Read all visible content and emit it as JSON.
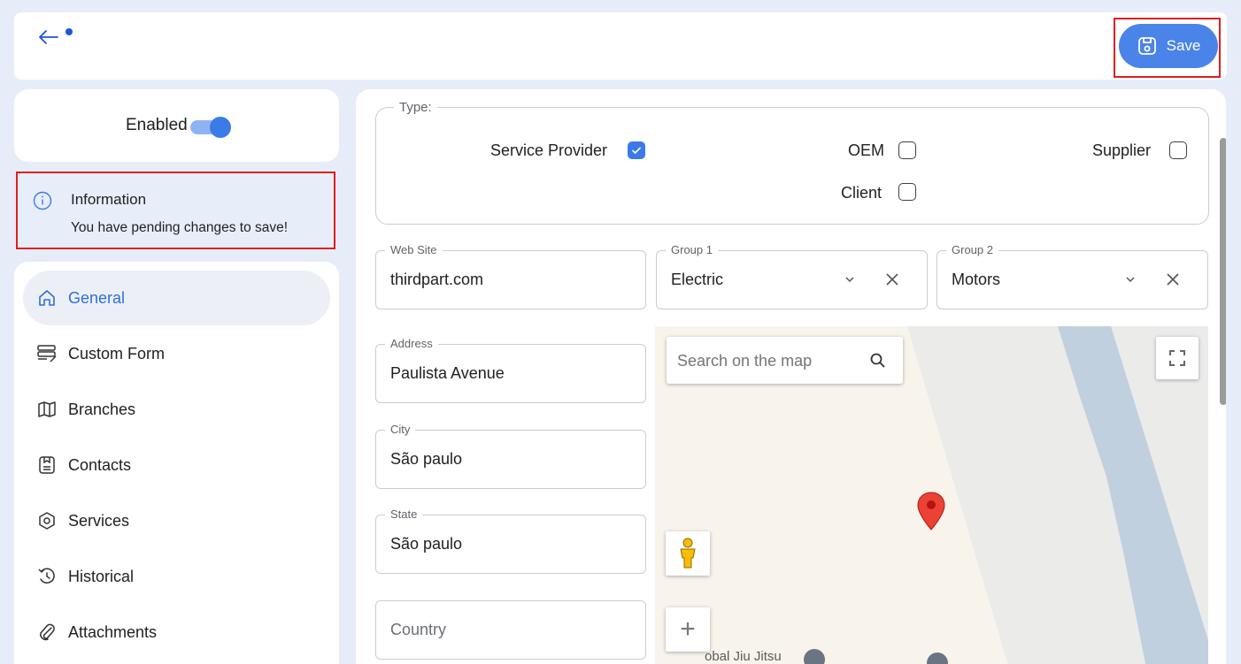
{
  "header": {
    "back_icon": "arrow-left-icon",
    "save_label": "Save",
    "save_icon": "floppy-disk-icon",
    "accent": "#4a84e8"
  },
  "status": {
    "enabled_label": "Enabled",
    "enabled": true
  },
  "notice": {
    "title": "Information",
    "message": "You have pending changes to save!",
    "icon": "info-icon"
  },
  "nav": {
    "items": [
      {
        "label": "General",
        "icon": "home-icon",
        "active": true
      },
      {
        "label": "Custom Form",
        "icon": "form-icon"
      },
      {
        "label": "Branches",
        "icon": "map-icon"
      },
      {
        "label": "Contacts",
        "icon": "contact-book-icon"
      },
      {
        "label": "Services",
        "icon": "hexagon-icon"
      },
      {
        "label": "Historical",
        "icon": "history-icon"
      },
      {
        "label": "Attachments",
        "icon": "paperclip-icon"
      }
    ]
  },
  "type": {
    "legend": "Type:",
    "options": [
      {
        "label": "Service Provider",
        "checked": true
      },
      {
        "label": "OEM",
        "checked": false
      },
      {
        "label": "Supplier",
        "checked": false
      },
      {
        "label": "Client",
        "checked": false
      }
    ]
  },
  "fields": {
    "website": {
      "label": "Web Site",
      "value": "thirdpart.com"
    },
    "group1": {
      "label": "Group 1",
      "value": "Electric"
    },
    "group2": {
      "label": "Group 2",
      "value": "Motors"
    },
    "address": {
      "label": "Address",
      "value": "Paulista Avenue"
    },
    "city": {
      "label": "City",
      "value": "São paulo"
    },
    "state": {
      "label": "State",
      "value": "São paulo"
    },
    "country": {
      "placeholder": "Country"
    }
  },
  "map": {
    "search_placeholder": "Search on the map",
    "poi_label": "obal Jiu Jitsu",
    "zoom_in": "+"
  }
}
